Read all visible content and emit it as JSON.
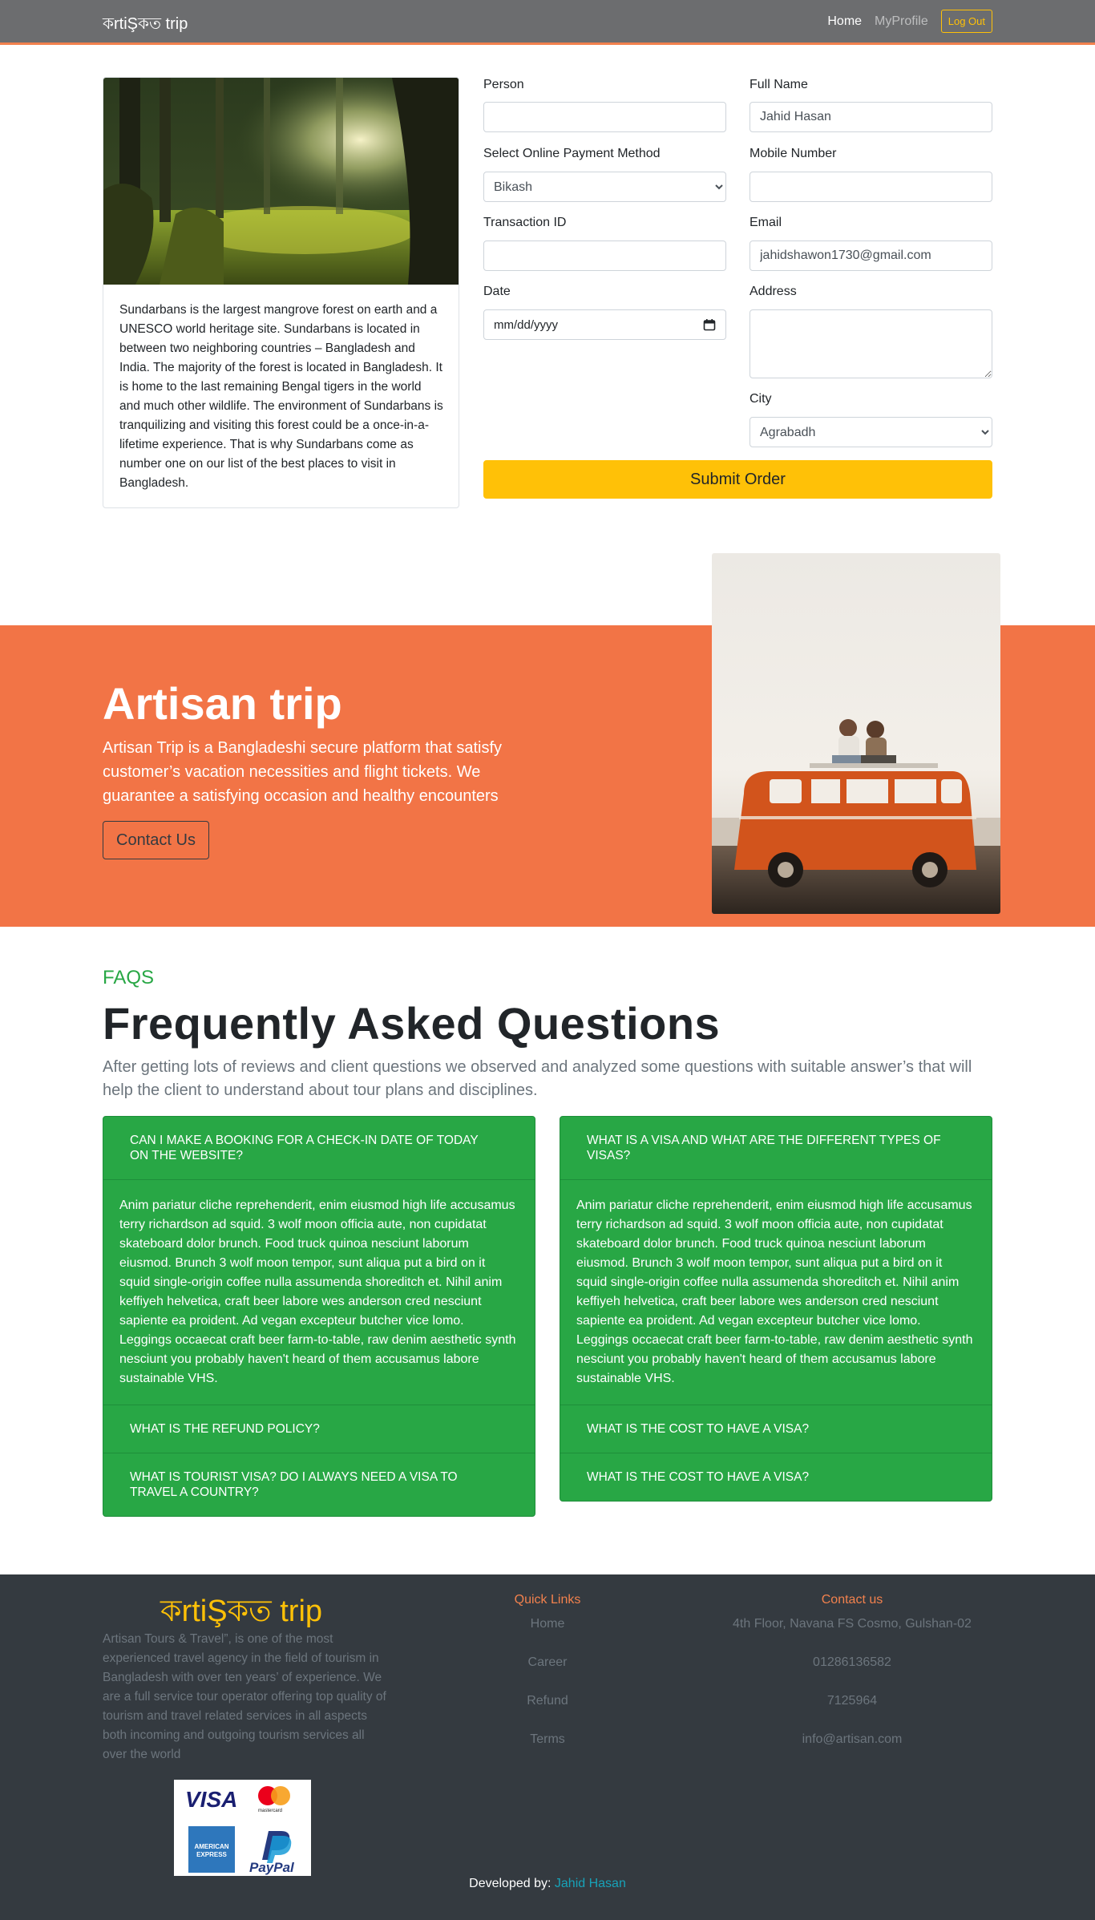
{
  "navbar": {
    "brand": "কrtiŞকত trip",
    "links": [
      {
        "label": "Home"
      },
      {
        "label": "MyProfile"
      }
    ],
    "logout_label": "Log Out"
  },
  "place": {
    "description": "Sundarbans is the largest mangrove forest on earth and a UNESCO world heritage site. Sundarbans is located in between two neighboring countries – Bangladesh and India. The majority of the forest is located in Bangladesh. It is home to the last remaining Bengal tigers in the world and much other wildlife. The environment of Sundarbans is tranquilizing and visiting this forest could be a once-in-a-lifetime experience. That is why Sundarbans come as number one on our list of the best places to visit in Bangladesh."
  },
  "form": {
    "person_label": "Person",
    "person_value": "",
    "payment_label": "Select Online Payment Method",
    "payment_value": "Bikash",
    "transaction_label": "Transaction ID",
    "transaction_value": "",
    "date_label": "Date",
    "date_placeholder": "mm/dd/yyyy",
    "fullname_label": "Full Name",
    "fullname_value": "Jahid Hasan",
    "mobile_label": "Mobile Number",
    "mobile_value": "",
    "email_label": "Email",
    "email_value": "jahidshawon1730@gmail.com",
    "address_label": "Address",
    "city_label": "City",
    "city_value": "Agrabadh",
    "submit_label": "Submit Order"
  },
  "hero": {
    "title": "Artisan trip",
    "text": "Artisan Trip is a Bangladeshi secure platform that satisfy customer’s vacation necessities and flight tickets. We guarantee a satisfying occasion and healthy encounters",
    "button": "Contact Us"
  },
  "faq": {
    "kicker": "FAQS",
    "title": "Frequently Asked Questions",
    "lead": "After getting lots of reviews and client questions we observed and analyzed some questions with suitable answer’s that will help the client to understand about tour plans and disciplines.",
    "answer": "Anim pariatur cliche reprehenderit, enim eiusmod high life accusamus terry richardson ad squid. 3 wolf moon officia aute, non cupidatat skateboard dolor brunch. Food truck quinoa nesciunt laborum eiusmod. Brunch 3 wolf moon tempor, sunt aliqua put a bird on it squid single-origin coffee nulla assumenda shoreditch et. Nihil anim keffiyeh helvetica, craft beer labore wes anderson cred nesciunt sapiente ea proident. Ad vegan excepteur butcher vice lomo. Leggings occaecat craft beer farm-to-table, raw denim aesthetic synth nesciunt you probably haven't heard of them accusamus labore sustainable VHS.",
    "left": [
      "Can I make a booking for a check-in date of today on the website?",
      "What is the refund policy?",
      "What is tourist visa? Do I always need a visa to travel a country?"
    ],
    "right": [
      "What is a visa and what are the different types of visas?",
      "What is the cost to have a visa?",
      "What is the cost to have a visa?"
    ]
  },
  "footer": {
    "logo": "কrtiŞকত trip",
    "about": "Artisan Tours & Travel”, is one of the most experienced travel agency in the field of tourism in Bangladesh with over ten years’ of experience. We are a full service tour operator offering top quality of tourism and travel related services in all aspects both incoming and outgoing tourism services all over the world",
    "payment_logos": {
      "visa": "VISA",
      "mastercard": "mastercard",
      "amex": "AMERICAN EXPRESS",
      "paypal": "PayPal"
    },
    "quick_links_title": "Quick Links",
    "quick_links": [
      "Home",
      "Career",
      "Refund",
      "Terms"
    ],
    "contact_title": "Contact us",
    "contact": [
      "4th Floor, Navana FS Cosmo, Gulshan-02",
      "01286136582",
      "7125964",
      "info@artisan.com"
    ],
    "developed_by_label": "Developed by:",
    "developer": "Jahid Hasan"
  },
  "colors": {
    "accent_orange": "#f27446",
    "success_green": "#28a745",
    "warning_yellow": "#ffc107",
    "footer_dark": "#343a40"
  }
}
